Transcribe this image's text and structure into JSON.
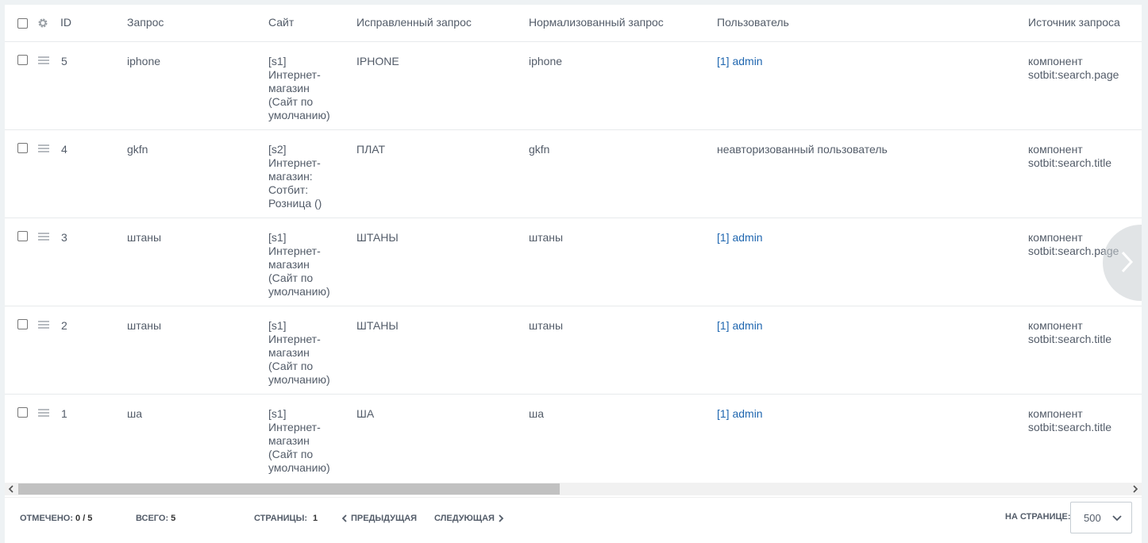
{
  "columns": {
    "id": "ID",
    "query": "Запрос",
    "site": "Сайт",
    "corrected": "Исправленный запрос",
    "normalized": "Нормализованный запрос",
    "user": "Пользователь",
    "source": "Источник запроса"
  },
  "rows": [
    {
      "id": "5",
      "query": "iphone",
      "site": "[s1] Интернет-магазин (Сайт по умолчанию)",
      "corrected": "IPHONE",
      "normalized": "iphone",
      "user": "[1] admin",
      "user_is_link": true,
      "source": "компонент sotbit:search.page"
    },
    {
      "id": "4",
      "query": "gkfn",
      "site": "[s2] Интернет-магазин: Сотбит: Розница ()",
      "corrected": "ПЛАТ",
      "normalized": "gkfn",
      "user": "неавторизованный пользователь",
      "user_is_link": false,
      "source": "компонент sotbit:search.title"
    },
    {
      "id": "3",
      "query": "штаны",
      "site": "[s1] Интернет-магазин (Сайт по умолчанию)",
      "corrected": "ШТАНЫ",
      "normalized": "штаны",
      "user": "[1] admin",
      "user_is_link": true,
      "source": "компонент sotbit:search.page"
    },
    {
      "id": "2",
      "query": "штаны",
      "site": "[s1] Интернет-магазин (Сайт по умолчанию)",
      "corrected": "ШТАНЫ",
      "normalized": "штаны",
      "user": "[1] admin",
      "user_is_link": true,
      "source": "компонент sotbit:search.title"
    },
    {
      "id": "1",
      "query": "ша",
      "site": "[s1] Интернет-магазин (Сайт по умолчанию)",
      "corrected": "ША",
      "normalized": "ша",
      "user": "[1] admin",
      "user_is_link": true,
      "source": "компонент sotbit:search.title"
    }
  ],
  "footer": {
    "selected_label": "Отмечено:",
    "selected_value": "0 / 5",
    "total_label": "Всего:",
    "total_value": "5",
    "pages_label": "Страницы:",
    "pages_value": "1",
    "prev_label": "Предыдущая",
    "next_label": "Следующая",
    "per_page_label": "На странице:",
    "per_page_value": "500"
  },
  "icons": {
    "settings": "gear-icon",
    "drag": "drag-handle-icon",
    "next": "chevron-right-icon",
    "prev": "chevron-left-icon",
    "dropdown": "chevron-down-icon"
  },
  "colors": {
    "link": "#2067b0",
    "text": "#535c69",
    "background": "#eef2f4"
  }
}
